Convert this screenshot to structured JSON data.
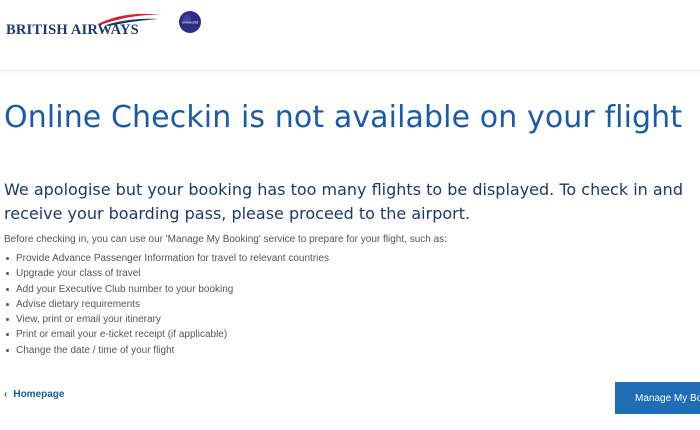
{
  "header": {
    "brand_name": "BRITISH AIRWAYS",
    "alliance_logo_text": "oneworld",
    "colors": {
      "brand_navy": "#1b3a6b",
      "swoosh_red": "#d8212e",
      "alliance_purple": "#2d2e83"
    }
  },
  "main": {
    "title": "Online Checkin is not available on your flight",
    "message": "We apologise but your booking has too many flights to be displayed. To check in and receive your boarding pass, please proceed to the airport.",
    "intro": "Before checking in, you can use our 'Manage My Booking' service to prepare for your flight, such as:",
    "features": [
      "Provide Advance Passenger Information for travel to relevant countries",
      "Upgrade your class of travel",
      "Add your Executive Club number to your booking",
      "Advise dietary requirements",
      "View, print or email your itinerary",
      "Print or email your e-ticket receipt (if applicable)",
      "Change the date / time of your flight"
    ]
  },
  "footer": {
    "homepage_link": "Homepage",
    "homepage_icon": "chevron-left-icon",
    "manage_button": "Manage My Booking",
    "button_color": "#1f6eb5"
  }
}
